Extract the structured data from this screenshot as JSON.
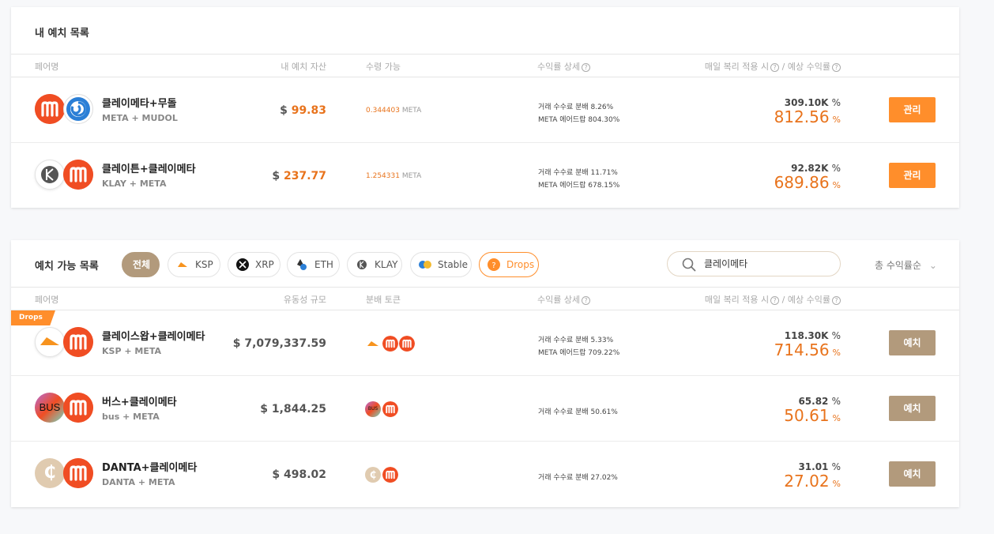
{
  "my_deposits": {
    "title": "내 예치 목록",
    "headers": {
      "pair": "페어명",
      "my_asset": "내 예치 자산",
      "claimable": "수령 가능",
      "yield_detail": "수익률 상세",
      "apy": "매일 복리 적용 시",
      "apy_sep": "/",
      "expected": "예상 수익률",
      "q": "?"
    },
    "rows": [
      {
        "name": "클레이메타+무돌",
        "sub": "META + MUDOL",
        "amount_prefix": "$",
        "amount": "99.83",
        "claim_value": "0.344403",
        "claim_unit": "META",
        "detail1": "거래 수수료 분배 8.26%",
        "detail2": "META 에어드랍 804.30%",
        "pct": "309.10K",
        "pct_unit": "%",
        "apy": "812.56",
        "apy_unit": "%",
        "button": "관리"
      },
      {
        "name": "클레이튼+클레이메타",
        "sub": "KLAY + META",
        "amount_prefix": "$",
        "amount": "237.77",
        "claim_value": "1.254331",
        "claim_unit": "META",
        "detail1": "거래 수수료 분배 11.71%",
        "detail2": "META 에어드랍 678.15%",
        "pct": "92.82K",
        "pct_unit": "%",
        "apy": "689.86",
        "apy_unit": "%",
        "button": "관리"
      }
    ]
  },
  "available": {
    "title": "예치 가능 목록",
    "filters": {
      "all": "전체",
      "ksp": "KSP",
      "xrp": "XRP",
      "eth": "ETH",
      "klay": "KLAY",
      "stable": "Stable",
      "drops": "Drops"
    },
    "search_value": "클레이메타",
    "sort_label": "총 수익률순",
    "sort_chevron": "⌄",
    "headers": {
      "pair": "페어명",
      "liquidity": "유동성 규모",
      "dist_token": "분배 토큰",
      "yield_detail": "수익률 상세",
      "apy": "매일 복리 적용 시",
      "apy_sep": "/",
      "expected": "예상 수익률",
      "q": "?"
    },
    "ribbon": "Drops",
    "rows": [
      {
        "name": "클레이스왑+클레이메타",
        "sub": "KSP + META",
        "amount": "$ 7,079,337.59",
        "detail1": "거래 수수료 분배 5.33%",
        "detail2": "META 에어드랍 709.22%",
        "pct": "118.30K",
        "pct_unit": "%",
        "apy": "714.56",
        "apy_unit": "%",
        "button": "예치"
      },
      {
        "name": "버스+클레이메타",
        "sub": "bus + META",
        "icon_text": "BUS",
        "token_text": "BUS",
        "amount": "$ 1,844.25",
        "detail1": "거래 수수료 분배 50.61%",
        "pct": "65.82",
        "pct_unit": "%",
        "apy": "50.61",
        "apy_unit": "%",
        "button": "예치"
      },
      {
        "name": "DANTA+클레이메타",
        "sub": "DANTA + META",
        "icon_text": "₵",
        "token_text": "₵",
        "amount": "$ 498.02",
        "detail1": "거래 수수료 분배 27.02%",
        "pct": "31.01",
        "pct_unit": "%",
        "apy": "27.02",
        "apy_unit": "%",
        "button": "예치"
      }
    ]
  },
  "colors": {
    "accent_orange": "#ff8e2b",
    "value_orange": "#e8731c",
    "deposit_brown": "#b29a7c",
    "meta_red": "#f04d23"
  }
}
